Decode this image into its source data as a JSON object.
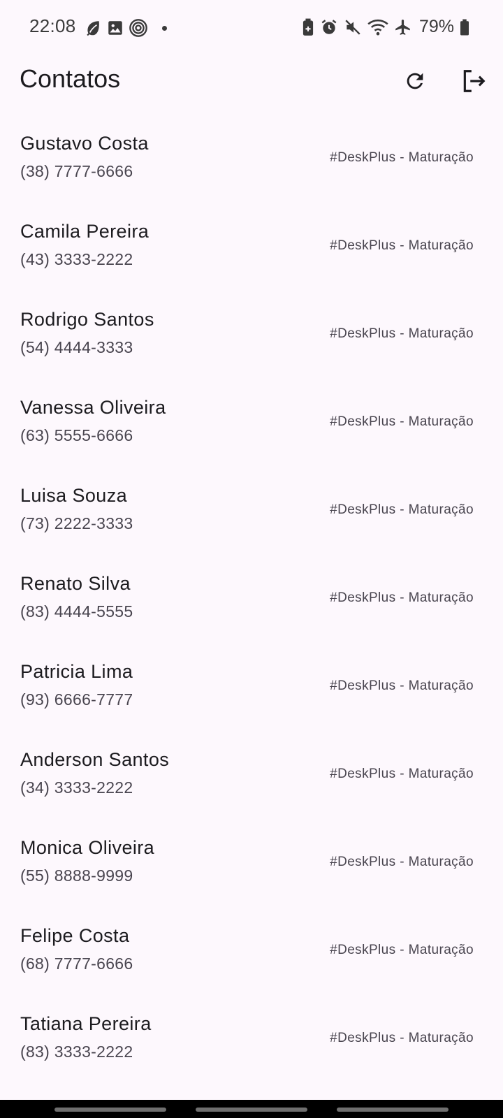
{
  "status_bar": {
    "time": "22:08",
    "battery_text": "79%",
    "left_icons": [
      "leaf-icon",
      "image-icon",
      "fingerprint-icon",
      "dot-icon"
    ],
    "right_icons": [
      "battery-saver-icon",
      "alarm-icon",
      "mute-icon",
      "wifi-icon",
      "airplane-icon",
      "battery-icon"
    ]
  },
  "app_bar": {
    "title": "Contatos",
    "actions": [
      "refresh-icon",
      "logout-icon"
    ]
  },
  "contacts": [
    {
      "name": "Gustavo Costa",
      "phone": "(38) 7777-6666",
      "tag": "#DeskPlus - Maturação"
    },
    {
      "name": "Camila Pereira",
      "phone": "(43) 3333-2222",
      "tag": "#DeskPlus - Maturação"
    },
    {
      "name": "Rodrigo Santos",
      "phone": "(54) 4444-3333",
      "tag": "#DeskPlus - Maturação"
    },
    {
      "name": "Vanessa Oliveira",
      "phone": "(63) 5555-6666",
      "tag": "#DeskPlus - Maturação"
    },
    {
      "name": "Luisa Souza",
      "phone": "(73) 2222-3333",
      "tag": "#DeskPlus - Maturação"
    },
    {
      "name": "Renato Silva",
      "phone": "(83) 4444-5555",
      "tag": "#DeskPlus - Maturação"
    },
    {
      "name": "Patricia Lima",
      "phone": "(93) 6666-7777",
      "tag": "#DeskPlus - Maturação"
    },
    {
      "name": "Anderson Santos",
      "phone": "(34) 3333-2222",
      "tag": "#DeskPlus - Maturação"
    },
    {
      "name": "Monica Oliveira",
      "phone": "(55) 8888-9999",
      "tag": "#DeskPlus - Maturação"
    },
    {
      "name": "Felipe Costa",
      "phone": "(68) 7777-6666",
      "tag": "#DeskPlus - Maturação"
    },
    {
      "name": "Tatiana Pereira",
      "phone": "(83) 3333-2222",
      "tag": "#DeskPlus - Maturação"
    }
  ],
  "colors": {
    "background": "#fdf8fd",
    "text_primary": "#1c1b1f",
    "text_secondary": "#49454f",
    "nav_bar": "#000000"
  }
}
